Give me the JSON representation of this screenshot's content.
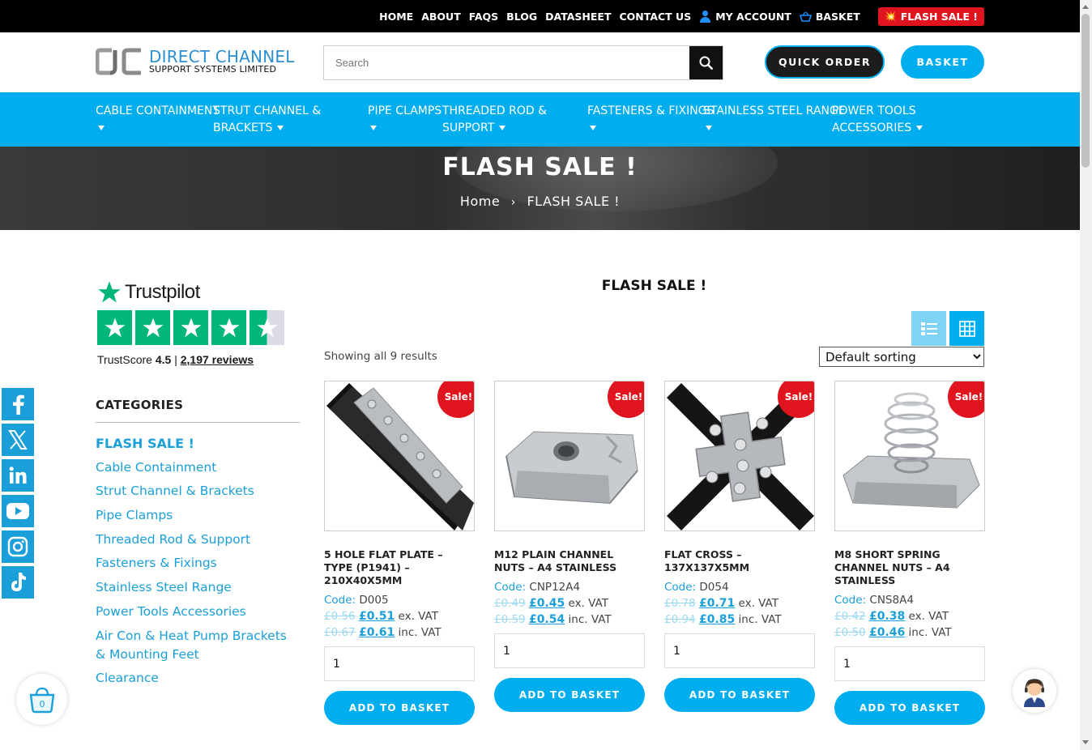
{
  "topnav": {
    "home": "HOME",
    "about": "ABOUT",
    "faqs": "FAQS",
    "blog": "BLOG",
    "datasheet": "DATASHEET",
    "contact": "CONTACT US",
    "account": "MY ACCOUNT",
    "basket": "BASKET",
    "flash": "FLASH SALE !",
    "flash_icon": "💥"
  },
  "logo": {
    "line1": "DIRECT CHANNEL",
    "line2": "SUPPORT SYSTEMS LIMITED"
  },
  "search": {
    "placeholder": "Search"
  },
  "header_buttons": {
    "quick_order": "QUICK ORDER",
    "basket": "BASKET"
  },
  "mainnav": [
    {
      "line1": "CABLE CONTAINMENT",
      "line2": ""
    },
    {
      "line1": "STRUT CHANNEL &",
      "line2": "BRACKETS"
    },
    {
      "line1": "PIPE CLAMPS",
      "line2": ""
    },
    {
      "line1": "THREADED ROD &",
      "line2": "SUPPORT"
    },
    {
      "line1": "FASTENERS & FIXINGS",
      "line2": ""
    },
    {
      "line1": "STAINLESS STEEL RANGE",
      "line2": ""
    },
    {
      "line1": "POWER TOOLS",
      "line2": "ACCESSORIES"
    }
  ],
  "hero": {
    "title": "FLASH SALE !",
    "breadcrumb_home": "Home",
    "breadcrumb_sep": "›",
    "breadcrumb_current": "FLASH SALE !"
  },
  "trustpilot": {
    "brand": "Trustpilot",
    "score_label": "TrustScore",
    "score": "4.5",
    "divider": "|",
    "reviews": "2,197 reviews"
  },
  "sidebar": {
    "heading": "CATEGORIES",
    "categories": [
      "FLASH SALE !",
      "Cable Containment",
      "Strut Channel & Brackets",
      "Pipe Clamps",
      "Threaded Rod & Support",
      "Fasteners & Fixings",
      "Stainless Steel Range",
      "Power Tools Accessories",
      "Air Con & Heat Pump Brackets & Mounting Feet",
      "Clearance"
    ]
  },
  "social": [
    "facebook-icon",
    "x-icon",
    "linkedin-icon",
    "youtube-icon",
    "instagram-icon",
    "tiktok-icon"
  ],
  "floating": {
    "basket_count": "0"
  },
  "shop": {
    "title": "FLASH SALE !",
    "result_count": "Showing all 9 results",
    "sorting": "Default sorting"
  },
  "products": [
    {
      "sale": "Sale!",
      "name": "5 HOLE FLAT PLATE – TYPE (P1941) – 210X40X5MM",
      "code_label": "Code:",
      "code": "D005",
      "was_ex": "£0.56",
      "now_ex": "£0.51",
      "ex_label": "ex. VAT",
      "was_inc": "£0.67",
      "now_inc": "£0.61",
      "inc_label": "inc. VAT",
      "qty": "1",
      "button": "ADD TO BASKET"
    },
    {
      "sale": "Sale!",
      "name": "M12 PLAIN CHANNEL NUTS – A4 STAINLESS",
      "code_label": "Code:",
      "code": "CNP12A4",
      "was_ex": "£0.49",
      "now_ex": "£0.45",
      "ex_label": "ex. VAT",
      "was_inc": "£0.59",
      "now_inc": "£0.54",
      "inc_label": "inc. VAT",
      "qty": "1",
      "button": "ADD TO BASKET"
    },
    {
      "sale": "Sale!",
      "name": "FLAT CROSS – 137X137X5MM",
      "code_label": "Code:",
      "code": "D054",
      "was_ex": "£0.78",
      "now_ex": "£0.71",
      "ex_label": "ex. VAT",
      "was_inc": "£0.94",
      "now_inc": "£0.85",
      "inc_label": "inc. VAT",
      "qty": "1",
      "button": "ADD TO BASKET"
    },
    {
      "sale": "Sale!",
      "name": "M8 SHORT SPRING CHANNEL NUTS – A4 STAINLESS",
      "code_label": "Code:",
      "code": "CNS8A4",
      "was_ex": "£0.42",
      "now_ex": "£0.38",
      "ex_label": "ex. VAT",
      "was_inc": "£0.50",
      "now_inc": "£0.46",
      "inc_label": "inc. VAT",
      "qty": "1",
      "button": "ADD TO BASKET"
    }
  ],
  "colors": {
    "accent": "#00aeef",
    "link": "#1a9fd8",
    "sale": "#e0141e",
    "trustpilot": "#00b67a"
  }
}
